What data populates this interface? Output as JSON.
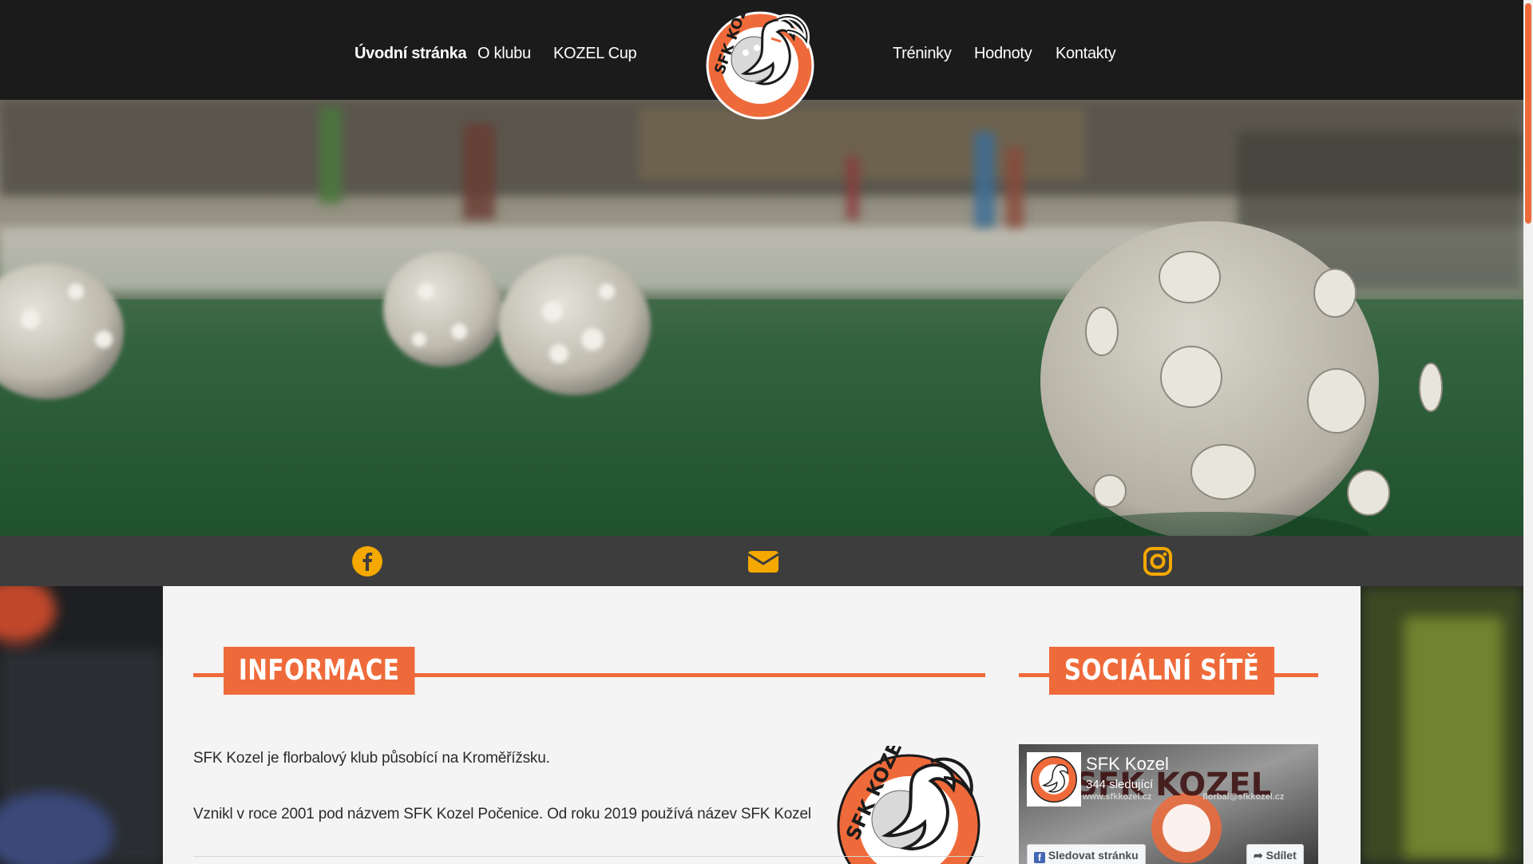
{
  "nav": {
    "left_items": [
      "Úvodní stránka",
      "O klubu",
      "KOZEL Cup"
    ],
    "right_items": [
      "Tréninky",
      "Hodnoty",
      "Kontakty"
    ],
    "active_index": 0
  },
  "logo": {
    "text": "SFK KOZEL",
    "brand_color": "#ef6a3a"
  },
  "social_strip": {
    "icons": [
      "facebook-icon",
      "envelope-icon",
      "instagram-icon"
    ],
    "icon_color": "#f5a800"
  },
  "info_section": {
    "heading": "INFORMACE",
    "paragraphs": [
      "SFK Kozel je florbalový klub působící na Kroměřížsku.",
      "Vznikl v roce 2001 pod názvem  SFK Kozel Počenice. Od roku 2019 používá název SFK Kozel"
    ]
  },
  "social_section": {
    "heading": "SOCIÁLNÍ SÍTĚ",
    "facebook_widget": {
      "page_name": "SFK Kozel",
      "followers": "344 sledující",
      "cover_text": "SFK KOZEL",
      "cover_url_left": "www.sfkkozel.cz",
      "cover_url_right": "florbal@sfkkozel.cz",
      "follow_button": "Sledovat stránku",
      "share_button": "Sdílet"
    }
  },
  "colors": {
    "accent": "#ef6a3a",
    "header_bg": "#1b1b1b",
    "strip_bg": "#3d3d3d",
    "panel_bg": "#f4f4f4"
  }
}
